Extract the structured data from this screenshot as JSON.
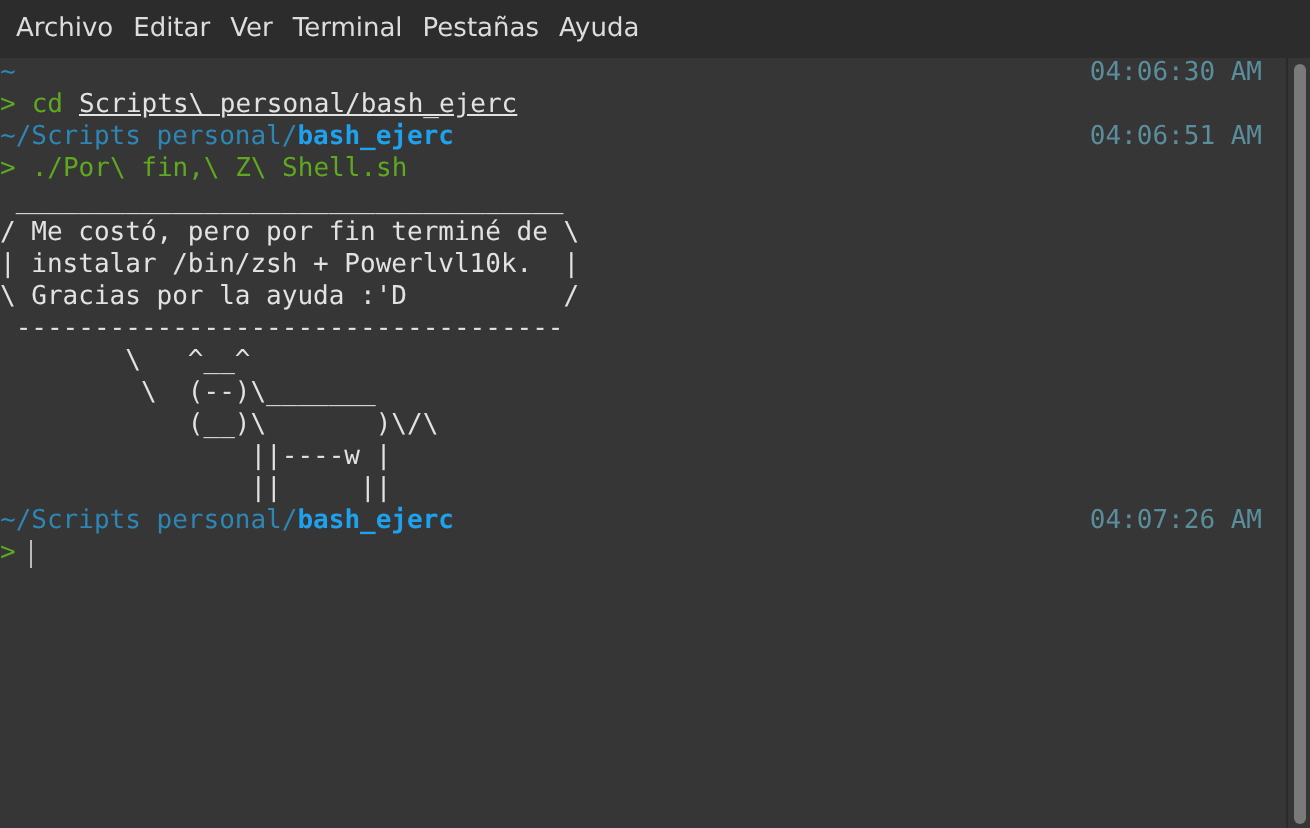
{
  "menu": [
    "Archivo",
    "Editar",
    "Ver",
    "Terminal",
    "Pestañas",
    "Ayuda"
  ],
  "lines": [
    {
      "kind": "path",
      "path": "~",
      "time": "04:06:30 AM"
    },
    {
      "kind": "command",
      "prompt": ">",
      "parts": [
        {
          "text": "cd",
          "link": false
        },
        {
          "text": "Scripts\\ personal/bash_ejerc",
          "link": true
        }
      ]
    },
    {
      "kind": "path",
      "path": "~/Scripts personal/**bash_ejerc**",
      "time": "04:06:51 AM"
    },
    {
      "kind": "command",
      "prompt": ">",
      "parts": [
        {
          "text": "./Por\\ fin,\\ Z\\ Shell.sh",
          "link": false
        }
      ]
    },
    {
      "kind": "output",
      "text": " ___________________________________"
    },
    {
      "kind": "output",
      "text": "/ Me costó, pero por fin terminé de \\"
    },
    {
      "kind": "output",
      "text": "| instalar /bin/zsh + Powerlvl10k.  |"
    },
    {
      "kind": "output",
      "text": "\\ Gracias por la ayuda :'D          /"
    },
    {
      "kind": "output",
      "text": " -----------------------------------"
    },
    {
      "kind": "output",
      "text": "        \\   ^__^"
    },
    {
      "kind": "output",
      "text": "         \\  (--)\\_______"
    },
    {
      "kind": "output",
      "text": "            (__)\\       )\\/\\"
    },
    {
      "kind": "output",
      "text": "                ||----w |"
    },
    {
      "kind": "output",
      "text": "                ||     ||"
    },
    {
      "kind": "path",
      "path": "~/Scripts personal/**bash_ejerc**",
      "time": "04:07:26 AM"
    },
    {
      "kind": "command",
      "prompt": ">",
      "cursor": true
    }
  ]
}
